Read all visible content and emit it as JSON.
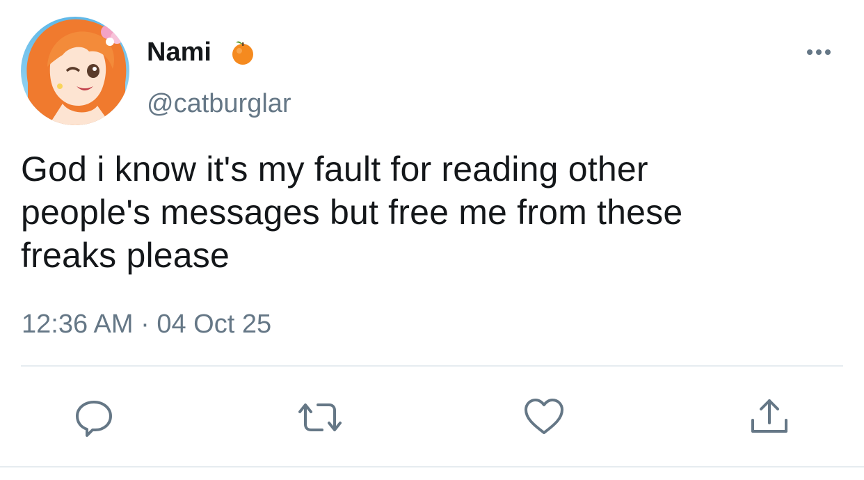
{
  "tweet": {
    "author": {
      "display_name": "Nami",
      "handle": "@catburglar",
      "badge_icon": "orange-emoji-icon",
      "avatar_icon": "anime-character-avatar"
    },
    "text_lines": [
      "God i know it's my fault for reading other",
      "people's messages but free me from these",
      "freaks please"
    ],
    "timestamp": "12:36 AM · 04 Oct 25",
    "actions": [
      "reply-icon",
      "retweet-icon",
      "like-icon",
      "share-icon"
    ],
    "menu_icon": "more-options-icon"
  },
  "colors": {
    "text_primary": "#14171a",
    "text_secondary": "#657786",
    "icon": "#657786",
    "divider": "#e6ecf0",
    "orange": "#f58a1f"
  }
}
